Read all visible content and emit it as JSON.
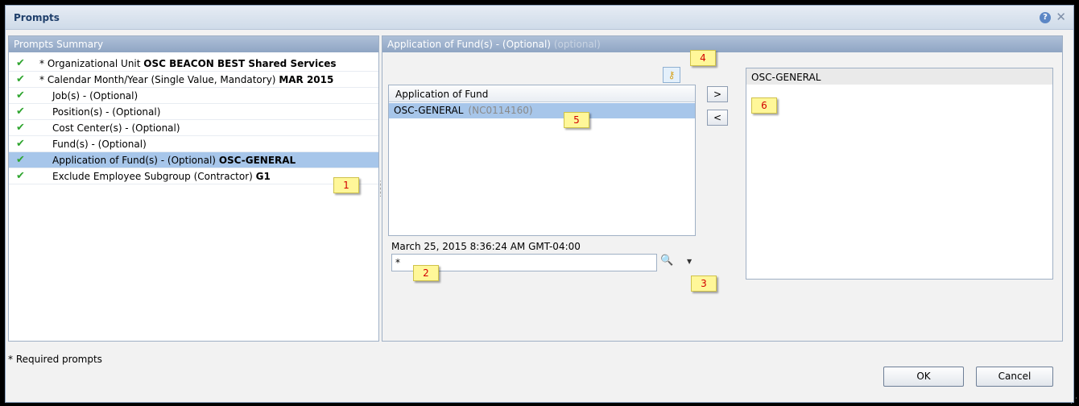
{
  "dialog": {
    "title": "Prompts",
    "help_icon": "?",
    "close_icon": "✕"
  },
  "summary": {
    "header": "Prompts Summary",
    "items": [
      {
        "label": "* Organizational Unit",
        "value": "OSC BEACON BEST Shared Services",
        "required": true,
        "selected": false
      },
      {
        "label": "* Calendar Month/Year (Single Value, Mandatory)",
        "value": "MAR 2015",
        "required": true,
        "selected": false
      },
      {
        "label": "Job(s) - (Optional)",
        "value": "",
        "required": false,
        "selected": false
      },
      {
        "label": "Position(s) - (Optional)",
        "value": "",
        "required": false,
        "selected": false
      },
      {
        "label": "Cost Center(s) - (Optional)",
        "value": "",
        "required": false,
        "selected": false
      },
      {
        "label": "Fund(s) - (Optional)",
        "value": "",
        "required": false,
        "selected": false
      },
      {
        "label": "Application of Fund(s) - (Optional)",
        "value": "OSC-GENERAL",
        "required": false,
        "selected": true
      },
      {
        "label": "Exclude Employee Subgroup (Contractor)",
        "value": "G1",
        "required": false,
        "selected": false
      }
    ]
  },
  "detail": {
    "header_title": "Application of Fund(s) - (Optional)",
    "header_optional": "(optional)",
    "lov_column_header": "Application of Fund",
    "lov_rows": [
      {
        "value": "OSC-GENERAL",
        "key": "(NC0114160)"
      }
    ],
    "refresh_timestamp": "March 25, 2015 8:36:24 AM GMT-04:00",
    "search_value": "*",
    "add_label": ">",
    "remove_label": "<",
    "selected_values": [
      "OSC-GENERAL"
    ]
  },
  "badges": [
    "1",
    "2",
    "3",
    "4",
    "5",
    "6"
  ],
  "footer": {
    "required_note": "* Required prompts",
    "ok_label": "OK",
    "cancel_label": "Cancel"
  },
  "icons": {
    "check": "check-icon",
    "key": "key-icon",
    "search_options": "search-options-icon"
  },
  "colors": {
    "selection": "#a7c6ea",
    "header_blue": "#8fa5c3",
    "check_green": "#2fa52f",
    "badge_yellow": "#fff799",
    "badge_text": "#d20000"
  }
}
